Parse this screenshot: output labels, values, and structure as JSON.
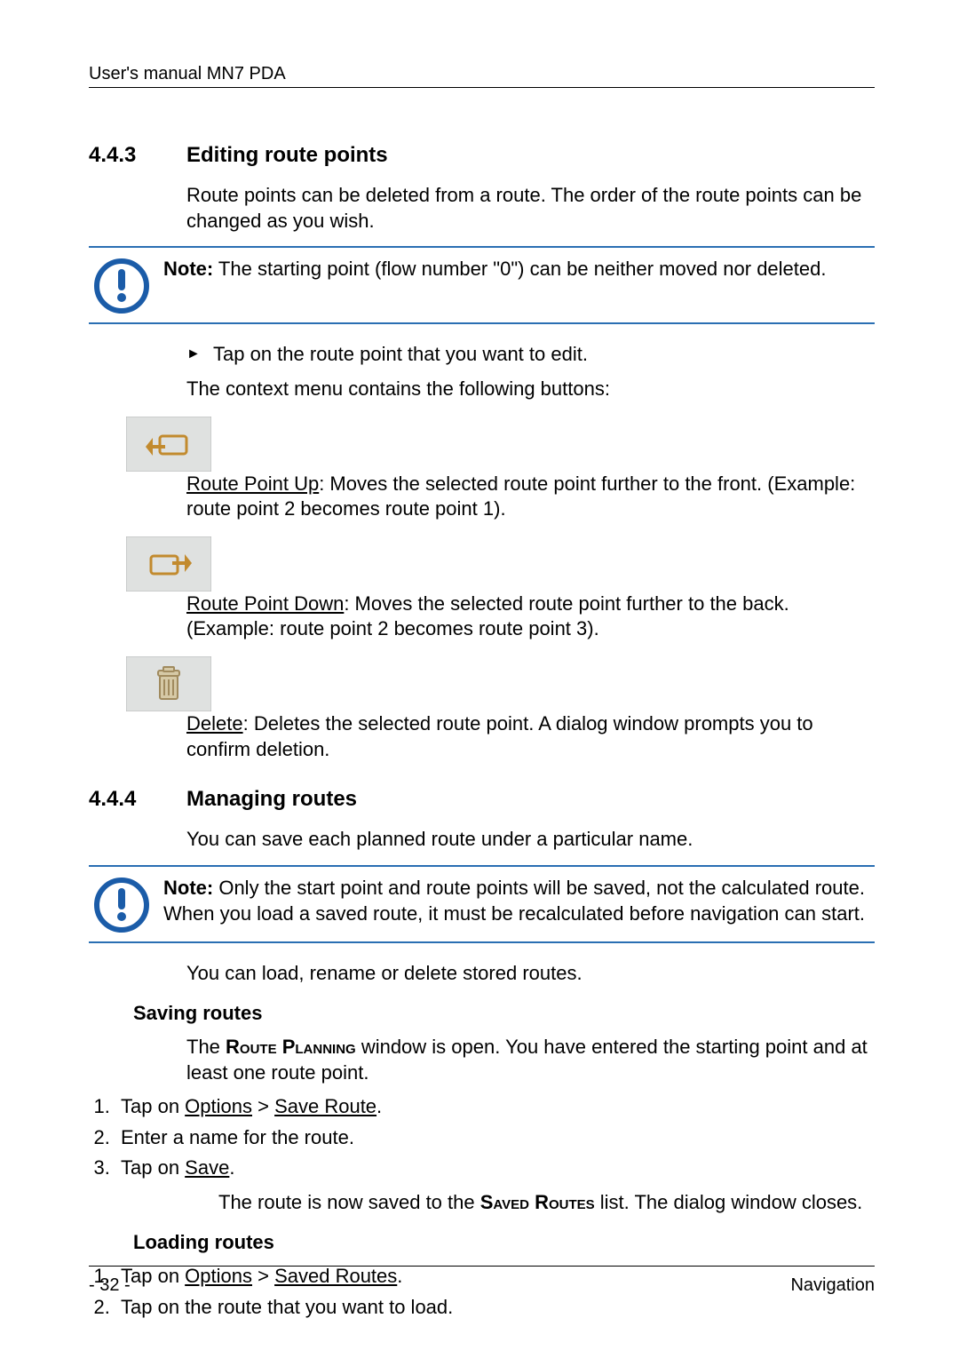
{
  "header": {
    "title": "User's manual MN7 PDA"
  },
  "section_443": {
    "number": "4.4.3",
    "title": "Editing route points",
    "intro": "Route points can be deleted from a route. The order of the route points can be changed as you wish.",
    "note_label": "Note:",
    "note_text": " The starting point (flow number \"0\") can be neither moved nor deleted.",
    "bullet1": "Tap on the route point that you want to edit.",
    "context_line": "The context menu contains the following buttons:",
    "btn_up_label": "Route Point Up",
    "btn_up_text": ": Moves the selected route point further to the front. (Example: route point 2 becomes route point 1).",
    "btn_down_label": "Route Point Down",
    "btn_down_text": ": Moves the selected route point further to the back. (Example: route point 2 becomes route point 3).",
    "btn_delete_label": "Delete",
    "btn_delete_text": ": Deletes the selected route point. A dialog window prompts you to confirm deletion."
  },
  "section_444": {
    "number": "4.4.4",
    "title": "Managing routes",
    "intro": "You can save each planned route under a particular name.",
    "note_label": "Note:",
    "note_text": " Only the start point and route points will be saved, not the calculated route. When you load a saved route, it must be recalculated before navigation can start.",
    "line_after_note": "You can load, rename or delete stored routes."
  },
  "saving": {
    "title": "Saving routes",
    "intro_pre": "The ",
    "intro_caps": "Route Planning",
    "intro_post": " window is open. You have entered the starting point and at least one route point.",
    "step1_pre": "Tap on ",
    "step1_link1": "Options",
    "step1_sep": " > ",
    "step1_link2": "Save Route",
    "step1_post": ".",
    "step2": "Enter a name for the route.",
    "step3_pre": "Tap on ",
    "step3_link": "Save",
    "step3_post": ".",
    "result_pre": "The route is now saved to the ",
    "result_caps": "Saved Routes",
    "result_post": " list. The dialog window closes."
  },
  "loading": {
    "title": "Loading routes",
    "step1_pre": "Tap on ",
    "step1_link1": "Options",
    "step1_sep": " > ",
    "step1_link2": "Saved Routes",
    "step1_post": ".",
    "step2": "Tap on the route that you want to load."
  },
  "footer": {
    "page": "- 32 -",
    "section": "Navigation"
  }
}
